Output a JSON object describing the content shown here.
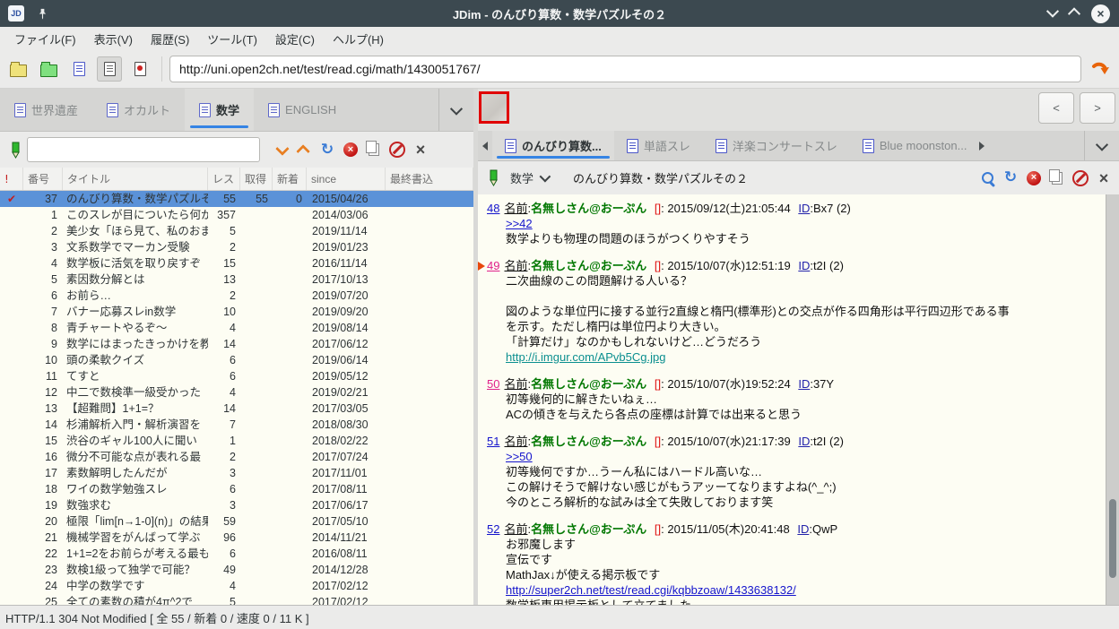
{
  "window": {
    "title": "JDim - のんびり算数・数学パズルその２"
  },
  "menu": {
    "items": [
      "ファイル(F)",
      "表示(V)",
      "履歴(S)",
      "ツール(T)",
      "設定(C)",
      "ヘルプ(H)"
    ]
  },
  "toolbar": {
    "url": "http://uni.open2ch.net/test/read.cgi/math/1430051767/"
  },
  "board_tabs": {
    "items": [
      {
        "label": "世界遺産",
        "active": false
      },
      {
        "label": "オカルト",
        "active": false
      },
      {
        "label": "数学",
        "active": true
      },
      {
        "label": "ENGLISH",
        "active": false
      }
    ]
  },
  "board_toolbar": {
    "search_value": ""
  },
  "thread_list": {
    "columns": [
      "!",
      "番号",
      "タイトル",
      "レス",
      "取得",
      "新着",
      "since",
      "最終書込"
    ],
    "rows": [
      {
        "mark": "✔",
        "num": "37",
        "title": "のんびり算数・数学パズルその",
        "res": "55",
        "got": "55",
        "new": "0",
        "since": "2015/04/26",
        "selected": true
      },
      {
        "num": "1",
        "title": "このスレが目についたら何か",
        "res": "357",
        "since": "2014/03/06"
      },
      {
        "num": "2",
        "title": "美少女「ほら見て、私のおま",
        "res": "5",
        "since": "2019/11/14"
      },
      {
        "num": "3",
        "title": "文系数学でマーカン受験",
        "res": "2",
        "since": "2019/01/23"
      },
      {
        "num": "4",
        "title": "数学板に活気を取り戻すぞ",
        "res": "15",
        "since": "2016/11/14"
      },
      {
        "num": "5",
        "title": "素因数分解とは",
        "res": "13",
        "since": "2017/10/13"
      },
      {
        "num": "6",
        "title": "お前ら…",
        "res": "2",
        "since": "2019/07/20"
      },
      {
        "num": "7",
        "title": "バナー応募スレin数学",
        "res": "10",
        "since": "2019/09/20"
      },
      {
        "num": "8",
        "title": "青チャートやるぞ～",
        "res": "4",
        "since": "2019/08/14"
      },
      {
        "num": "9",
        "title": "数学にはまったきっかけを教",
        "res": "14",
        "since": "2017/06/12"
      },
      {
        "num": "10",
        "title": "頭の柔軟クイズ",
        "res": "6",
        "since": "2019/06/14"
      },
      {
        "num": "11",
        "title": "てすと",
        "res": "6",
        "since": "2019/05/12"
      },
      {
        "num": "12",
        "title": "中二で数検準一級受かった",
        "res": "4",
        "since": "2019/02/21"
      },
      {
        "num": "13",
        "title": "【超難問】1+1=？",
        "res": "14",
        "since": "2017/03/05"
      },
      {
        "num": "14",
        "title": "杉浦解析入門・解析演習を",
        "res": "7",
        "since": "2018/08/30"
      },
      {
        "num": "15",
        "title": "渋谷のギャル100人に聞い",
        "res": "1",
        "since": "2018/02/22"
      },
      {
        "num": "16",
        "title": "微分不可能な点が表れる最",
        "res": "2",
        "since": "2017/07/24"
      },
      {
        "num": "17",
        "title": "素数解明したんだが",
        "res": "3",
        "since": "2017/11/01"
      },
      {
        "num": "18",
        "title": "ワイの数学勉強スレ",
        "res": "6",
        "since": "2017/08/11"
      },
      {
        "num": "19",
        "title": "数強求む",
        "res": "3",
        "since": "2017/06/17"
      },
      {
        "num": "20",
        "title": "極限「lim[n→1-0](n)」の結果",
        "res": "59",
        "since": "2017/05/10"
      },
      {
        "num": "21",
        "title": "機械学習をがんばって学ぶ",
        "res": "96",
        "since": "2014/11/21"
      },
      {
        "num": "22",
        "title": "1+1=2をお前らが考える最も",
        "res": "6",
        "since": "2016/08/11"
      },
      {
        "num": "23",
        "title": "数検1級って独学で可能？",
        "res": "49",
        "since": "2014/12/28"
      },
      {
        "num": "24",
        "title": "中学の数学です",
        "res": "4",
        "since": "2017/02/12"
      },
      {
        "num": "25",
        "title": "全ての素数の積が4π^2で",
        "res": "5",
        "since": "2017/02/12"
      },
      {
        "num": "",
        "title": "",
        "res": "",
        "since": "",
        "partial": true
      }
    ]
  },
  "nav_buttons": {
    "prev": "<",
    "next": ">"
  },
  "thread_tabs": {
    "items": [
      {
        "label": "のんびり算数...",
        "active": true
      },
      {
        "label": "単語スレ",
        "active": false
      },
      {
        "label": "洋楽コンサートスレ",
        "active": false
      },
      {
        "label": "Blue moonston...",
        "active": false
      }
    ]
  },
  "thread_toolbar": {
    "board_name": "数学",
    "title": "のんびり算数・数学パズルその２"
  },
  "post_labels": {
    "name": "名前"
  },
  "posts": [
    {
      "num": "48",
      "num_color": "blue",
      "marker": false,
      "name": "名無しさん@おーぷん",
      "mail": "[]",
      "date": "2015/09/12(土)21:05:44",
      "id": "ID:Bx7",
      "count": "(2)",
      "lines": [
        {
          "t": ">>42",
          "y": "link"
        },
        {
          "t": "数学よりも物理の問題のほうがつくりやすそう"
        }
      ]
    },
    {
      "num": "49",
      "num_color": "pink",
      "marker": true,
      "name": "名無しさん@おーぷん",
      "mail": "[]",
      "date": "2015/10/07(水)12:51:19",
      "id": "ID:t2I",
      "count": "(2)",
      "lines": [
        {
          "t": "二次曲線のこの問題解ける人いる？"
        },
        {
          "t": ""
        },
        {
          "t": "図のような単位円に接する並行2直線と楕円(標準形)との交点が作る四角形は平行四辺形である事"
        },
        {
          "t": "を示す。ただし楕円は単位円より大きい。"
        },
        {
          "t": "「計算だけ」なのかもしれないけど…どうだろう"
        },
        {
          "t": "http://i.imgur.com/APvb5Cg.jpg",
          "y": "teal"
        }
      ]
    },
    {
      "num": "50",
      "num_color": "pink",
      "marker": false,
      "name": "名無しさん@おーぷん",
      "mail": "[]",
      "date": "2015/10/07(水)19:52:24",
      "id": "ID:37Y",
      "count": "",
      "lines": [
        {
          "t": "初等幾何的に解きたいねぇ…"
        },
        {
          "t": "ACの傾きを与えたら各点の座標は計算では出来ると思う"
        }
      ]
    },
    {
      "num": "51",
      "num_color": "blue",
      "marker": false,
      "name": "名無しさん@おーぷん",
      "mail": "[]",
      "date": "2015/10/07(水)21:17:39",
      "id": "ID:t2I",
      "count": "(2)",
      "lines": [
        {
          "t": ">>50",
          "y": "link"
        },
        {
          "t": "初等幾何ですか…うーん私にはハードル高いな…"
        },
        {
          "t": "この解けそうで解けない感じがもうアッーてなりますよね(^_^;)"
        },
        {
          "t": "今のところ解析的な試みは全て失敗しております笑"
        }
      ]
    },
    {
      "num": "52",
      "num_color": "blue",
      "marker": false,
      "name": "名無しさん@おーぷん",
      "mail": "[]",
      "date": "2015/11/05(木)20:41:48",
      "id": "ID:QwP",
      "count": "",
      "lines": [
        {
          "t": "お邪魔します"
        },
        {
          "t": "宣伝です"
        },
        {
          "t": "MathJax↓が使える掲示板です"
        },
        {
          "t": "http://super2ch.net/test/read.cgi/kqbbzoaw/1433638132/",
          "y": "link"
        },
        {
          "t": "数学板専用掲示板として立てました"
        }
      ]
    }
  ],
  "status_bar": {
    "text": "HTTP/1.1 304 Not Modified [ 全 55 / 新着 0 / 速度 0 / 11 K ]"
  },
  "colors": {
    "titlebar": "#3c4950",
    "accent_blue": "#3584e4",
    "selection_blue": "#5b92d8",
    "link_blue": "#1414cc",
    "link_pink": "#e0218a",
    "link_teal": "#0b8f8f",
    "name_green": "#007700",
    "mail_red": "#e01010",
    "marker_orange": "#e8480c",
    "list_bg": "#fdfdf3"
  }
}
